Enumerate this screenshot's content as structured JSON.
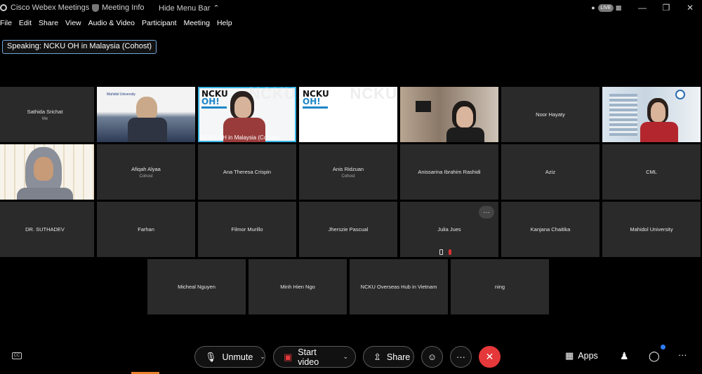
{
  "titlebar": {
    "app_name": "Cisco Webex Meetings",
    "meeting_info": "Meeting Info",
    "hide_menu": "Hide Menu Bar",
    "live_label": "LIVE"
  },
  "menu": [
    "File",
    "Edit",
    "Share",
    "View",
    "Audio & Video",
    "Participant",
    "Meeting",
    "Help"
  ],
  "speaking": {
    "prefix": "Speaking:",
    "name": "NCKU OH in Malaysia (Cohost)"
  },
  "rows": [
    [
      {
        "name": "Sathida Srichat",
        "sub": "Me",
        "video": false
      },
      {
        "name": "",
        "sub": "",
        "video": true,
        "scene": "mahidol",
        "caption": "Mahidol University"
      },
      {
        "name": "NCKU OH in Malaysia  (Cohost)",
        "sub": "",
        "video": true,
        "scene": "ncku-speaker",
        "active": true
      },
      {
        "name": "",
        "sub": "",
        "video": true,
        "scene": "ncku-slide"
      },
      {
        "name": "",
        "sub": "",
        "video": true,
        "scene": "room"
      },
      {
        "name": "Noor Hayaty",
        "sub": "",
        "video": false
      },
      {
        "name": "",
        "sub": "",
        "video": true,
        "scene": "building"
      }
    ],
    [
      {
        "name": "",
        "sub": "",
        "video": true,
        "scene": "hijab"
      },
      {
        "name": "Afiqah Alyaa",
        "sub": "Cohost",
        "video": false
      },
      {
        "name": "Ana Theresa Crispin",
        "sub": "",
        "video": false
      },
      {
        "name": "Anis Ridzuan",
        "sub": "Cohost",
        "video": false
      },
      {
        "name": "Anissarina Ibrahim Rashidi",
        "sub": "",
        "video": false
      },
      {
        "name": "Aziz",
        "sub": "",
        "video": false
      },
      {
        "name": "CML",
        "sub": "",
        "video": false
      }
    ],
    [
      {
        "name": "DR. SUTHADEV",
        "sub": "",
        "video": false
      },
      {
        "name": "Farhan",
        "sub": "",
        "video": false
      },
      {
        "name": "Filmor Murillo",
        "sub": "",
        "video": false
      },
      {
        "name": "Jherszie Pascual",
        "sub": "",
        "video": false
      },
      {
        "name": "Julia Jues",
        "sub": "",
        "video": false,
        "hover": true
      },
      {
        "name": "Kanjana Chaitika",
        "sub": "",
        "video": false
      },
      {
        "name": "Mahidol University",
        "sub": "",
        "video": false
      }
    ],
    [
      {
        "name": "Micheal Nguyen",
        "sub": "",
        "video": false
      },
      {
        "name": "Minh Hien Ngo",
        "sub": "",
        "video": false
      },
      {
        "name": "NCKU Overseas Hub in Vietnam",
        "sub": "",
        "video": false
      },
      {
        "name": "ning",
        "sub": "",
        "video": false
      }
    ]
  ],
  "ncku": {
    "line1": "NCKU",
    "line2": "OH!",
    "ghost": "NCKU"
  },
  "controls": {
    "unmute": "Unmute",
    "start_video": "Start video",
    "share": "Share",
    "apps": "Apps"
  },
  "colors": {
    "accent": "#38b6e8",
    "end": "#e5383b",
    "tile": "#2a2a2a"
  }
}
